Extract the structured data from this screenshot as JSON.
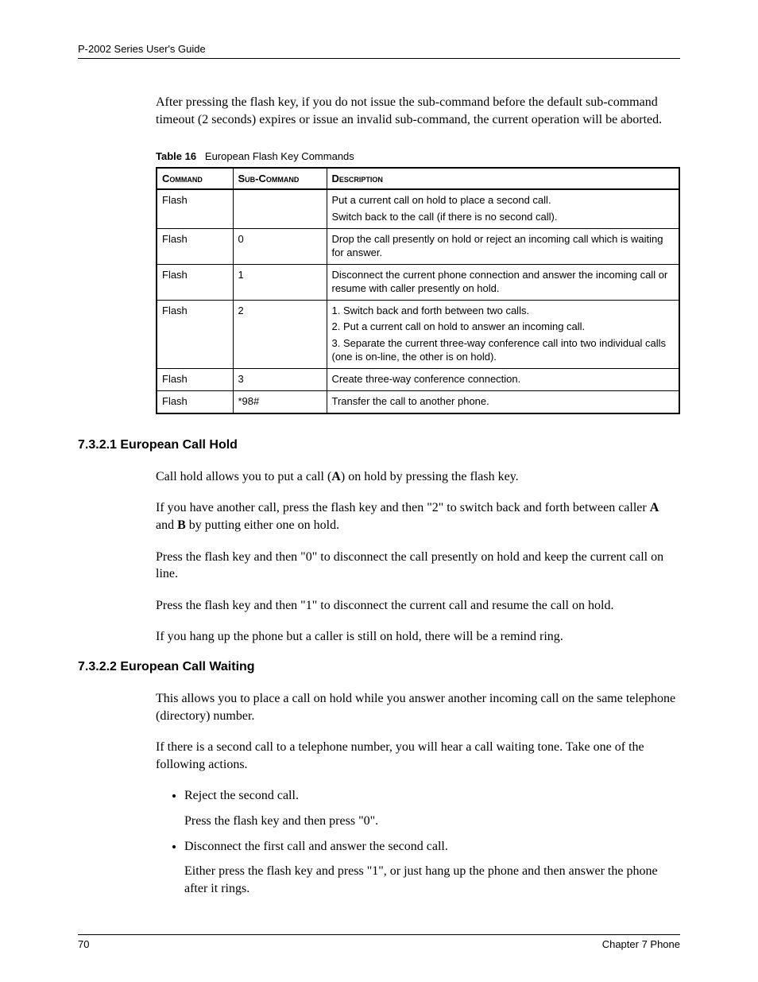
{
  "header": "P-2002 Series User's Guide",
  "intro": "After pressing the flash key, if you do not issue the sub-command before the default sub-command timeout (2 seconds) expires or issue an invalid sub-command, the current operation will be aborted.",
  "table_caption_label": "Table 16",
  "table_caption_text": "European Flash Key Commands",
  "table_headers": {
    "command": "Command",
    "sub": "Sub-Command",
    "desc": "Description"
  },
  "table_rows": [
    {
      "command": "Flash",
      "sub": "",
      "desc": [
        "Put a current call on hold to place a second call.",
        "Switch back to the call (if there is no second call)."
      ]
    },
    {
      "command": "Flash",
      "sub": "0",
      "desc": [
        "Drop the call presently on hold or reject an incoming call which is waiting for answer."
      ]
    },
    {
      "command": "Flash",
      "sub": "1",
      "desc": [
        "Disconnect the current phone connection and answer the incoming call or resume with caller presently on hold."
      ]
    },
    {
      "command": "Flash",
      "sub": "2",
      "desc": [
        "1. Switch back and forth between two calls.",
        "2. Put a current call on hold to answer an incoming call.",
        "3. Separate the current three-way conference call into two individual calls (one is on-line, the other is on hold)."
      ]
    },
    {
      "command": "Flash",
      "sub": "3",
      "desc": [
        "Create three-way conference connection."
      ]
    },
    {
      "command": "Flash",
      "sub": "*98#",
      "desc": [
        "Transfer the call to another phone."
      ]
    }
  ],
  "section1": {
    "heading": "7.3.2.1  European Call Hold",
    "p1_a": "Call hold allows you to put a call (",
    "p1_bold": "A",
    "p1_b": ") on hold by pressing the flash key.",
    "p2_a": "If you have another call, press the flash key and then \"2\" to switch back and forth between caller ",
    "p2_boldA": "A",
    "p2_mid": " and ",
    "p2_boldB": "B",
    "p2_b": " by putting either one on hold.",
    "p3": "Press the flash key and then \"0\" to disconnect the call presently on hold and keep the current call on line.",
    "p4": "Press the flash key and then \"1\" to disconnect the current call and resume the call on hold.",
    "p5": "If you hang up the phone but a caller is still on hold, there will be a remind ring."
  },
  "section2": {
    "heading": "7.3.2.2  European Call Waiting",
    "p1": "This allows you to place a call on hold while you answer another incoming call on the same telephone (directory) number.",
    "p2": "If there is a second call to a telephone number, you will hear a call waiting tone. Take one of the following actions.",
    "bullets": [
      {
        "main": "Reject the second call.",
        "sub": "Press the flash key and then press \"0\"."
      },
      {
        "main": "Disconnect the first call and answer the second call.",
        "sub": "Either press the flash key and press \"1\", or just hang up the phone and then answer the phone after it rings."
      }
    ]
  },
  "footer": {
    "page": "70",
    "chapter": "Chapter 7 Phone"
  }
}
